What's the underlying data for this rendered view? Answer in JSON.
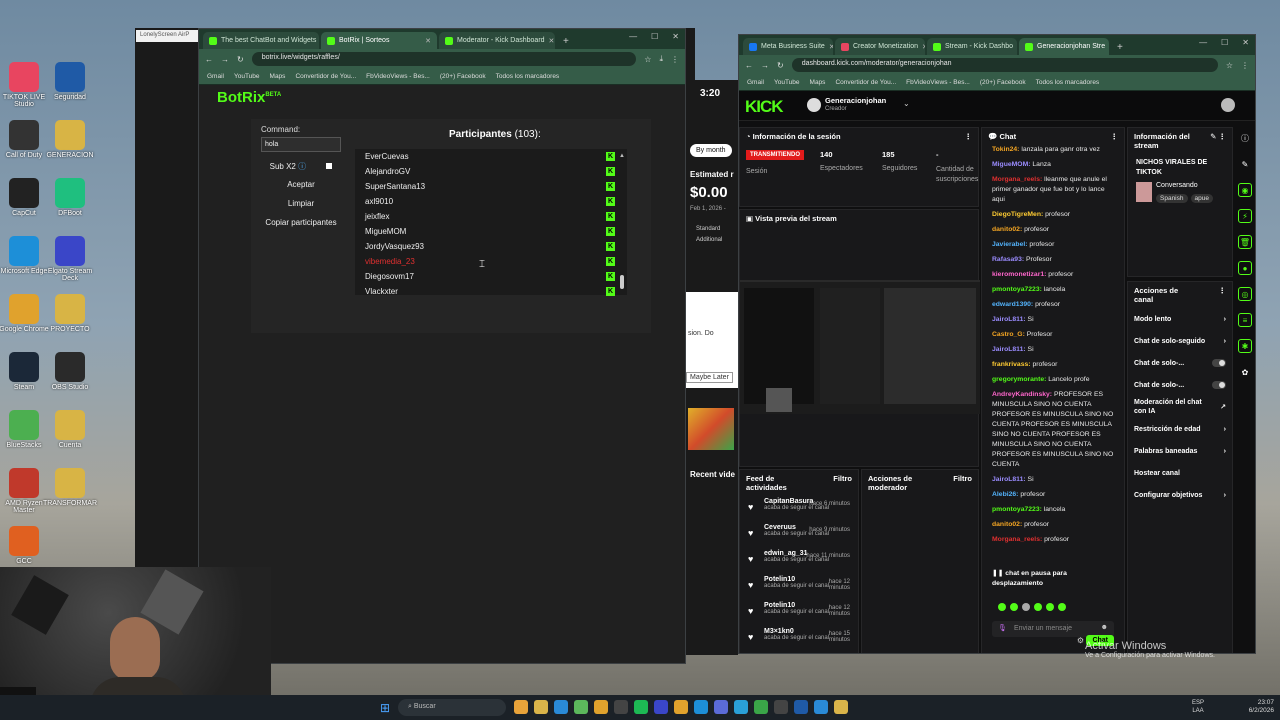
{
  "desktop_icons": [
    {
      "label": "TIKTOK LIVE Studio",
      "color": "#e84560"
    },
    {
      "label": "Seguridad",
      "color": "#1f5aa6"
    },
    {
      "label": "Call of Duty",
      "color": "#333333"
    },
    {
      "label": "GENERACION",
      "color": "#d8b445"
    },
    {
      "label": "CapCut",
      "color": "#222222"
    },
    {
      "label": "DFBoot",
      "color": "#1fbf7f"
    },
    {
      "label": "Microsoft Edge",
      "color": "#1d8fd8"
    },
    {
      "label": "Elgato Stream Deck",
      "color": "#3a46c8"
    },
    {
      "label": "Google Chrome",
      "color": "#e0a22d"
    },
    {
      "label": "PROYECTO",
      "color": "#d8b445"
    },
    {
      "label": "Steam",
      "color": "#1b2838"
    },
    {
      "label": "OBS Studio",
      "color": "#2a2a2a"
    },
    {
      "label": "BlueStacks",
      "color": "#4caf50"
    },
    {
      "label": "Cuenta",
      "color": "#d8b445"
    },
    {
      "label": "AMD Ryzen Master",
      "color": "#c0392b"
    },
    {
      "label": "TRANSFORMAR",
      "color": "#d8b445"
    },
    {
      "label": "GCC",
      "color": "#e06020"
    }
  ],
  "botrix_window": {
    "tabs": [
      {
        "label": "The best ChatBot and Widgets",
        "active": false,
        "color": "#53fc18"
      },
      {
        "label": "BotRix | Sorteos",
        "active": true,
        "color": "#53fc18"
      },
      {
        "label": "Moderator - Kick Dashboard",
        "active": false,
        "color": "#53fc18"
      }
    ],
    "url": "botrix.live/widgets/raffles/",
    "bookmarks": [
      "Gmail",
      "YouTube",
      "Maps",
      "Convertidor de You...",
      "FbVideoViews - Bes...",
      "(20+) Facebook",
      "Todos los marcadores"
    ],
    "logo": "BotRix",
    "logo_beta": "BETA",
    "command_label": "Command:",
    "command_value": "hola",
    "sub_label": "Sub X2",
    "buttons": {
      "accept": "Aceptar",
      "clean": "Limpiar",
      "copy": "Copiar participantes"
    },
    "participants_title": "Participantes",
    "participants_count": "(103):",
    "participants": [
      {
        "name": "EverCuevas",
        "red": false
      },
      {
        "name": "AlejandroGV",
        "red": false
      },
      {
        "name": "SuperSantana13",
        "red": false
      },
      {
        "name": "axl9010",
        "red": false
      },
      {
        "name": "jeixflex",
        "red": false
      },
      {
        "name": "MigueMOM",
        "red": false
      },
      {
        "name": "JordyVasquez93",
        "red": false
      },
      {
        "name": "vibemedia_23",
        "red": true
      },
      {
        "name": "Diegosovm17",
        "red": false
      },
      {
        "name": "Vlackxter",
        "red": false
      }
    ]
  },
  "mid_strip": {
    "time": "3:20",
    "by_month": "By month",
    "estimated": "Estimated r",
    "amount": "$0.00",
    "date": "Feb 1, 2026 -",
    "standard": "Standard",
    "additional": "Additional",
    "sion": "sion. Do",
    "maybe_later": "Maybe Later",
    "recent": "Recent vide"
  },
  "kick_window": {
    "tabs": [
      {
        "label": "Meta Business Suite",
        "active": false,
        "color": "#1877f2"
      },
      {
        "label": "Creator Monetization",
        "active": false,
        "color": "#e84560"
      },
      {
        "label": "Stream - Kick Dashbo",
        "active": false,
        "color": "#53fc18"
      },
      {
        "label": "Generacionjohan Stre",
        "active": true,
        "color": "#53fc18"
      }
    ],
    "url": "dashboard.kick.com/moderator/generacionjohan",
    "bookmarks": [
      "Gmail",
      "YouTube",
      "Maps",
      "Convertidor de You...",
      "FbVideoViews - Bes...",
      "(20+) Facebook",
      "Todos los marcadores"
    ],
    "logo": "KICK",
    "channel_name": "Generacionjohan",
    "channel_role": "Creador",
    "session": {
      "title": "Información de la sesión",
      "live_badge": "TRANSMITIENDO",
      "session_label": "Sesión",
      "viewers_value": "140",
      "viewers_label": "Espectadores",
      "followers_value": "185",
      "followers_label": "Seguidores",
      "subs_value": "-",
      "subs_label": "Cantidad de suscripciones"
    },
    "preview_title": "Vista previa del stream",
    "chat": {
      "title": "Chat",
      "messages": [
        {
          "user": "Tokin24:",
          "text": "lanzala para ganr otra vez",
          "color": "#f5a623"
        },
        {
          "user": "MigueMOM:",
          "text": "Lanza",
          "color": "#9b8cff"
        },
        {
          "user": "Morgana_reels:",
          "text": "lleanme que anule el primer ganador que fue bot y lo lance aqui",
          "color": "#e03030"
        },
        {
          "user": "DiegoTigreMen:",
          "text": "profesor",
          "color": "#ffcc33"
        },
        {
          "user": "danito02:",
          "text": "profesor",
          "color": "#f5a623"
        },
        {
          "user": "Javierabel:",
          "text": "profesor",
          "color": "#53b3fc"
        },
        {
          "user": "Rafasa93:",
          "text": "Profesor",
          "color": "#9b8cff"
        },
        {
          "user": "kieromonetizar1:",
          "text": "profesor",
          "color": "#ff66cc"
        },
        {
          "user": "pmontoya7223:",
          "text": "lancela",
          "color": "#53fc18"
        },
        {
          "user": "edward1390:",
          "text": "profesor",
          "color": "#53b3fc"
        },
        {
          "user": "JairoL811:",
          "text": "Si",
          "color": "#9b8cff"
        },
        {
          "user": "Castro_G:",
          "text": "Profesor",
          "color": "#f5a623"
        },
        {
          "user": "JairoL811:",
          "text": "Si",
          "color": "#9b8cff"
        },
        {
          "user": "frankrivass:",
          "text": "profesor",
          "color": "#ffcc33"
        },
        {
          "user": "gregorymorante:",
          "text": "Lancelo profe",
          "color": "#53fc18"
        },
        {
          "user": "AndreyKandinsky:",
          "text": "PROFESOR ES MINUSCULA SINO NO CUENTA PROFESOR ES MINUSCULA SINO NO CUENTA PROFESOR ES MINUSCULA SINO NO CUENTA PROFESOR ES MINUSCULA SINO NO CUENTA PROFESOR ES MINUSCULA SINO NO CUENTA",
          "color": "#ff66cc"
        },
        {
          "user": "JairoL811:",
          "text": "Si",
          "color": "#9b8cff"
        },
        {
          "user": "Alebi26:",
          "text": "profesor",
          "color": "#53b3fc"
        },
        {
          "user": "pmontoya7223:",
          "text": "lancela",
          "color": "#53fc18"
        },
        {
          "user": "danito02:",
          "text": "profesor",
          "color": "#f5a623"
        },
        {
          "user": "Morgana_reels:",
          "text": "profesor",
          "color": "#e03030"
        }
      ],
      "paused": "chat en pausa para desplazamiento",
      "input_placeholder": "Enviar un mensaje",
      "send_label": "Chat"
    },
    "stream_info": {
      "title": "Información del stream",
      "stream_title": "NICHOS VIRALES DE TIKTOK",
      "category": "Conversando",
      "tags": [
        "Spanish",
        "apue"
      ]
    },
    "channel_actions": {
      "title": "Acciones de canal",
      "items": [
        {
          "label": "Modo lento",
          "kind": "arrow"
        },
        {
          "label": "Chat de solo-seguido",
          "kind": "arrow"
        },
        {
          "label": "Chat de solo-...",
          "kind": "toggle"
        },
        {
          "label": "Chat de solo-...",
          "kind": "toggle"
        },
        {
          "label": "Moderación del chat con IA",
          "kind": "link"
        },
        {
          "label": "Restricción de edad",
          "kind": "arrow"
        },
        {
          "label": "Palabras baneadas",
          "kind": "arrow"
        },
        {
          "label": "Hostear canal",
          "kind": "none"
        },
        {
          "label": "Configurar objetivos",
          "kind": "arrow"
        }
      ]
    },
    "feed": {
      "title": "Feed de actividades",
      "filter": "Filtro",
      "items": [
        {
          "user": "CapitanBasura",
          "action": "acaba de seguir el canal",
          "time": "hace 6 minutos"
        },
        {
          "user": "Ceveruus",
          "action": "acaba de seguir el canal",
          "time": "hace 9 minutos"
        },
        {
          "user": "edwin_ag_31",
          "action": "acaba de seguir el canal",
          "time": "hace 11 minutos"
        },
        {
          "user": "Potelin10",
          "action": "acaba de seguir el canal",
          "time": "hace 12 minutos"
        },
        {
          "user": "Potelin10",
          "action": "acaba de seguir el canal",
          "time": "hace 12 minutos"
        },
        {
          "user": "M3×1kn0",
          "action": "acaba de seguir el canal",
          "time": "hace 15 minutos"
        }
      ]
    },
    "mod_actions": {
      "title": "Acciones de moderador",
      "filter": "Filtro"
    }
  },
  "windows_activation": {
    "title": "Activar Windows",
    "subtitle": "Ve a Configuración para activar Windows."
  },
  "taskbar": {
    "search_placeholder": "Buscar",
    "lang": "ESP",
    "lang2": "LAA",
    "time": "23:07",
    "date": "6/2/2026"
  },
  "accent": "#53fc18"
}
